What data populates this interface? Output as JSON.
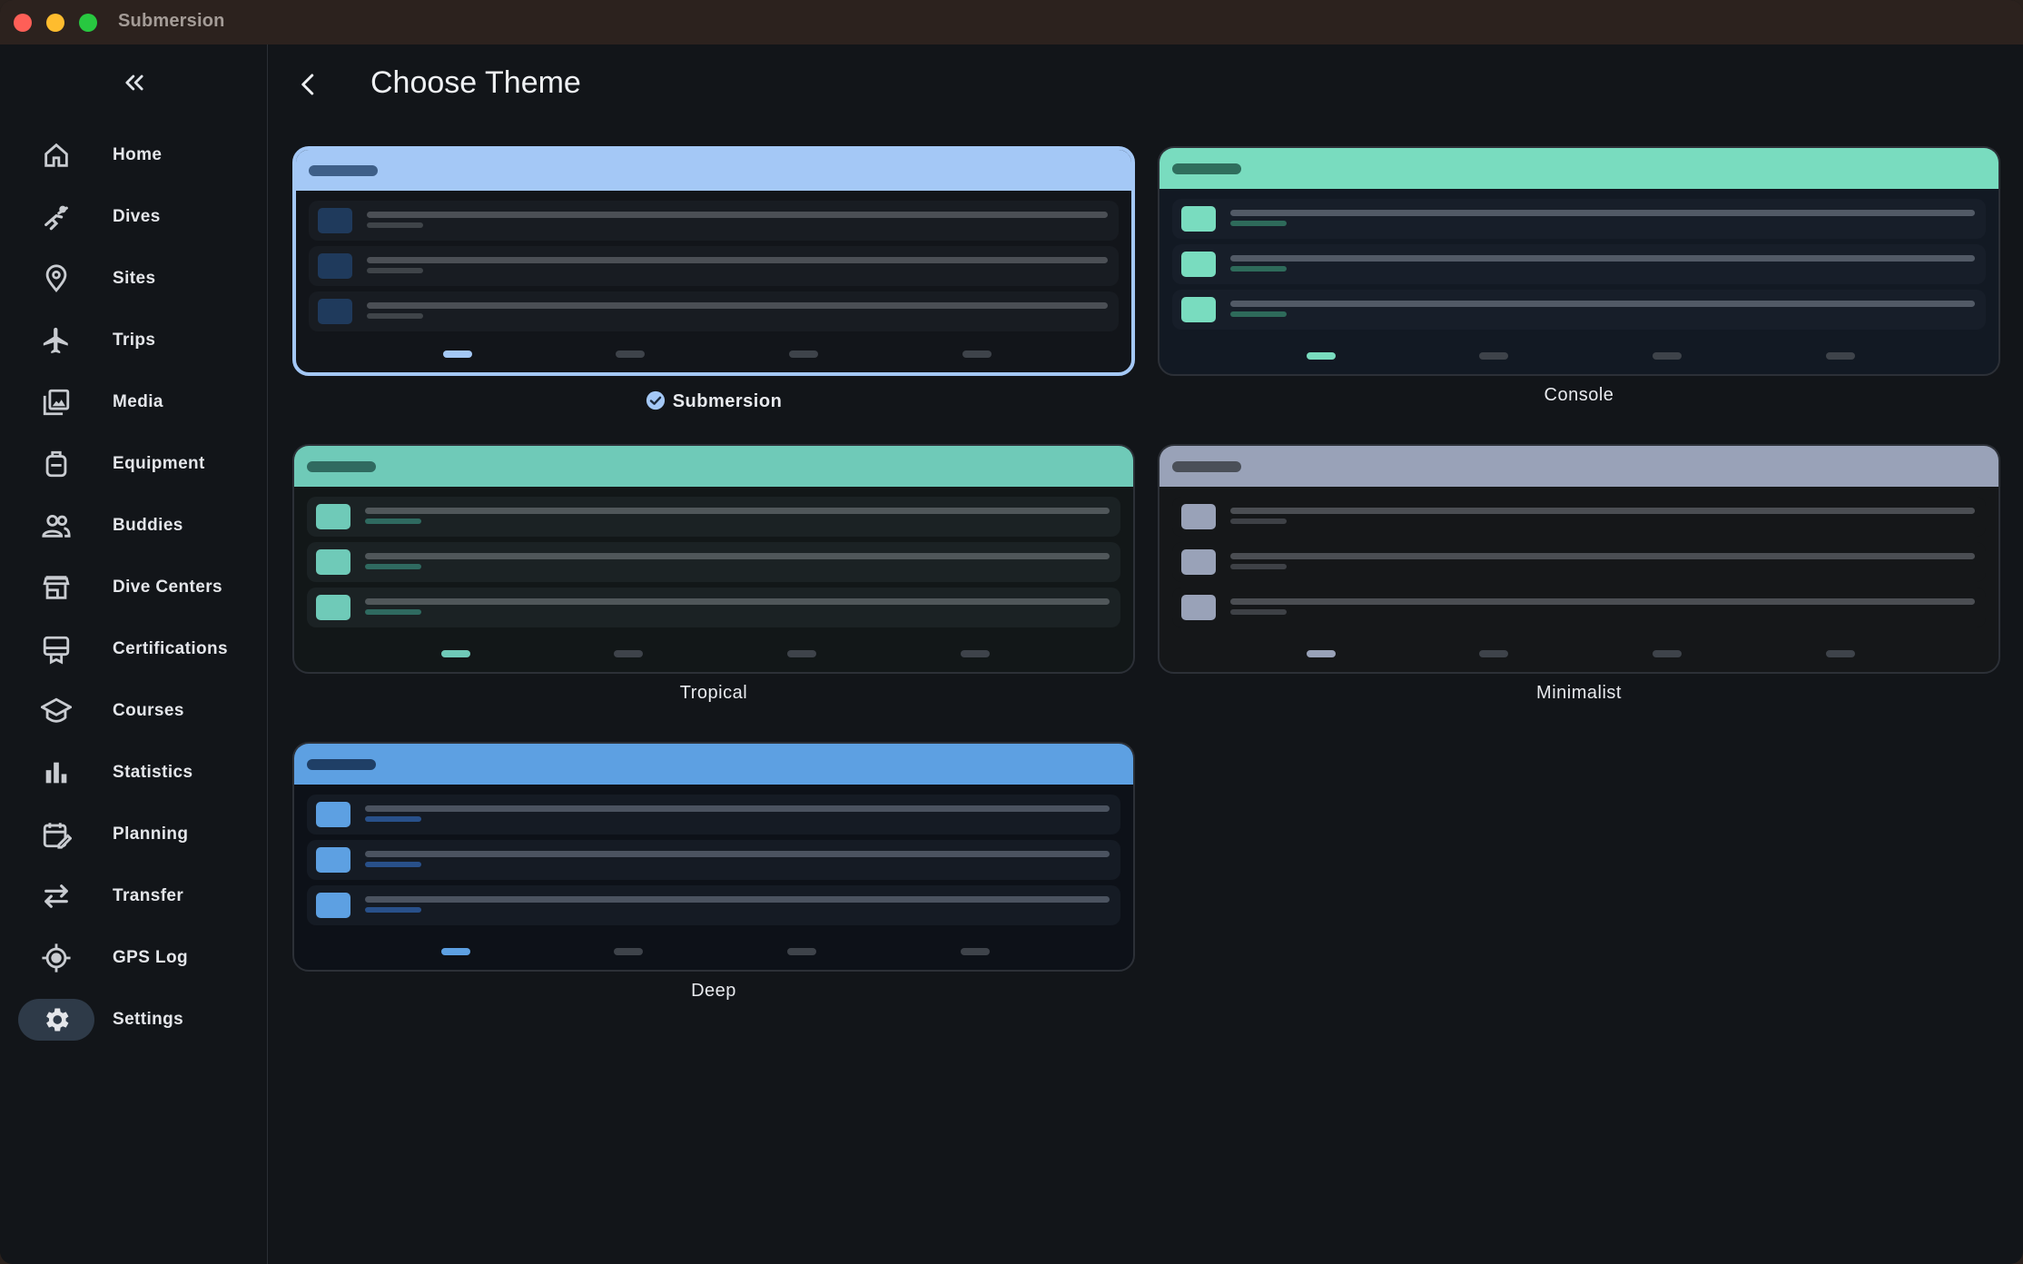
{
  "app": {
    "title": "Submersion"
  },
  "sidebar": {
    "collapse_icon": "double-chevron-left-icon",
    "items": [
      {
        "label": "Home",
        "icon": "home-icon"
      },
      {
        "label": "Dives",
        "icon": "diver-icon"
      },
      {
        "label": "Sites",
        "icon": "location-pin-icon"
      },
      {
        "label": "Trips",
        "icon": "airplane-icon"
      },
      {
        "label": "Media",
        "icon": "photo-library-icon"
      },
      {
        "label": "Equipment",
        "icon": "backpack-icon"
      },
      {
        "label": "Buddies",
        "icon": "people-icon"
      },
      {
        "label": "Dive Centers",
        "icon": "store-icon"
      },
      {
        "label": "Certifications",
        "icon": "card-membership-icon"
      },
      {
        "label": "Courses",
        "icon": "school-icon"
      },
      {
        "label": "Statistics",
        "icon": "bar-chart-icon"
      },
      {
        "label": "Planning",
        "icon": "calendar-edit-icon"
      },
      {
        "label": "Transfer",
        "icon": "swap-arrows-icon"
      },
      {
        "label": "GPS Log",
        "icon": "gps-target-icon"
      },
      {
        "label": "Settings",
        "icon": "gear-icon",
        "active": true
      }
    ]
  },
  "header": {
    "title": "Choose Theme",
    "back_icon": "chevron-left-icon"
  },
  "themes": [
    {
      "name": "Submersion",
      "selected": true,
      "header_color": "#a4c8f6",
      "pill_color": "#3e5f88",
      "body_color": "#12151a",
      "row_color": "#181c22",
      "square_color": "#1f3a5c",
      "line_color": "#4b4f55",
      "subline_color": "#3f4449",
      "active_dot": "#a4c8f6"
    },
    {
      "name": "Console",
      "selected": false,
      "header_color": "#79dcbf",
      "pill_color": "#2f6e5d",
      "body_color": "#121923",
      "row_color": "#171e29",
      "square_color": "#79dcbf",
      "line_color": "#525a66",
      "subline_color": "#2e6a5a",
      "active_dot": "#79dcbf"
    },
    {
      "name": "Tropical",
      "selected": false,
      "header_color": "#6fcab8",
      "pill_color": "#306a60",
      "body_color": "#121718",
      "row_color": "#1b2224",
      "square_color": "#6fcab8",
      "line_color": "#50575a",
      "subline_color": "#2f6a60",
      "active_dot": "#6fcab8"
    },
    {
      "name": "Minimalist",
      "selected": false,
      "header_color": "#99a2b8",
      "pill_color": "#4a4f58",
      "body_color": "#151719",
      "row_color": "#151719",
      "square_color": "#99a2b8",
      "line_color": "#4b4e53",
      "subline_color": "#3e4146",
      "active_dot": "#99a2b8"
    },
    {
      "name": "Deep",
      "selected": false,
      "header_color": "#5da0e2",
      "pill_color": "#1f3f66",
      "body_color": "#0d1118",
      "row_color": "#151b24",
      "square_color": "#5da0e2",
      "line_color": "#4b5360",
      "subline_color": "#28508a",
      "active_dot": "#5da0e2"
    }
  ],
  "selected_check_icon": "check-circle-icon"
}
